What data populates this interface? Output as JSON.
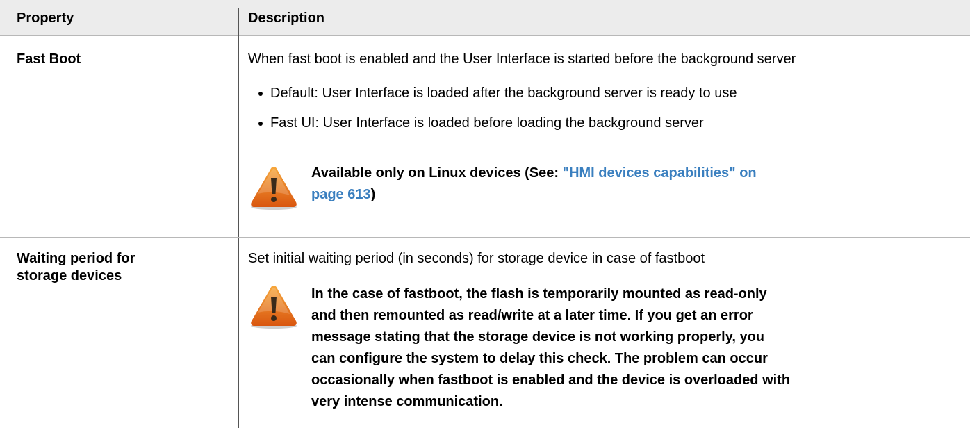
{
  "table": {
    "headers": {
      "property": "Property",
      "description": "Description"
    },
    "rows": [
      {
        "property": "Fast Boot",
        "description": "When fast boot is enabled and the User Interface is started before the background server",
        "bullets": [
          "Default: User Interface is loaded after the background server is ready to use",
          "Fast UI: User Interface is loaded before loading the background server"
        ],
        "note": {
          "icon": "warning-icon",
          "line1_prefix": "Available only on Linux devices (See: ",
          "line1_link": "\"HMI devices capabilities\" on",
          "line2_link": "page 613",
          "line2_suffix": ")"
        }
      },
      {
        "property_line1": "Waiting period for",
        "property_line2": "storage devices",
        "description": "Set initial waiting period (in seconds) for storage device in case of fastboot",
        "note": {
          "icon": "warning-icon",
          "lines": [
            "In the case of fastboot, the flash is temporarily mounted as read-only",
            "and then remounted as read/write at a later time. If you get an error",
            "message stating that the storage device is not working properly, you",
            "can configure the system to delay this check. The problem can occur",
            "occasionally when fastboot is enabled and the device is overloaded with",
            "very intense communication."
          ]
        }
      }
    ]
  },
  "colors": {
    "header_bg": "#ececec",
    "link": "#3a7fbf",
    "warning_orange": "#e8701a"
  }
}
